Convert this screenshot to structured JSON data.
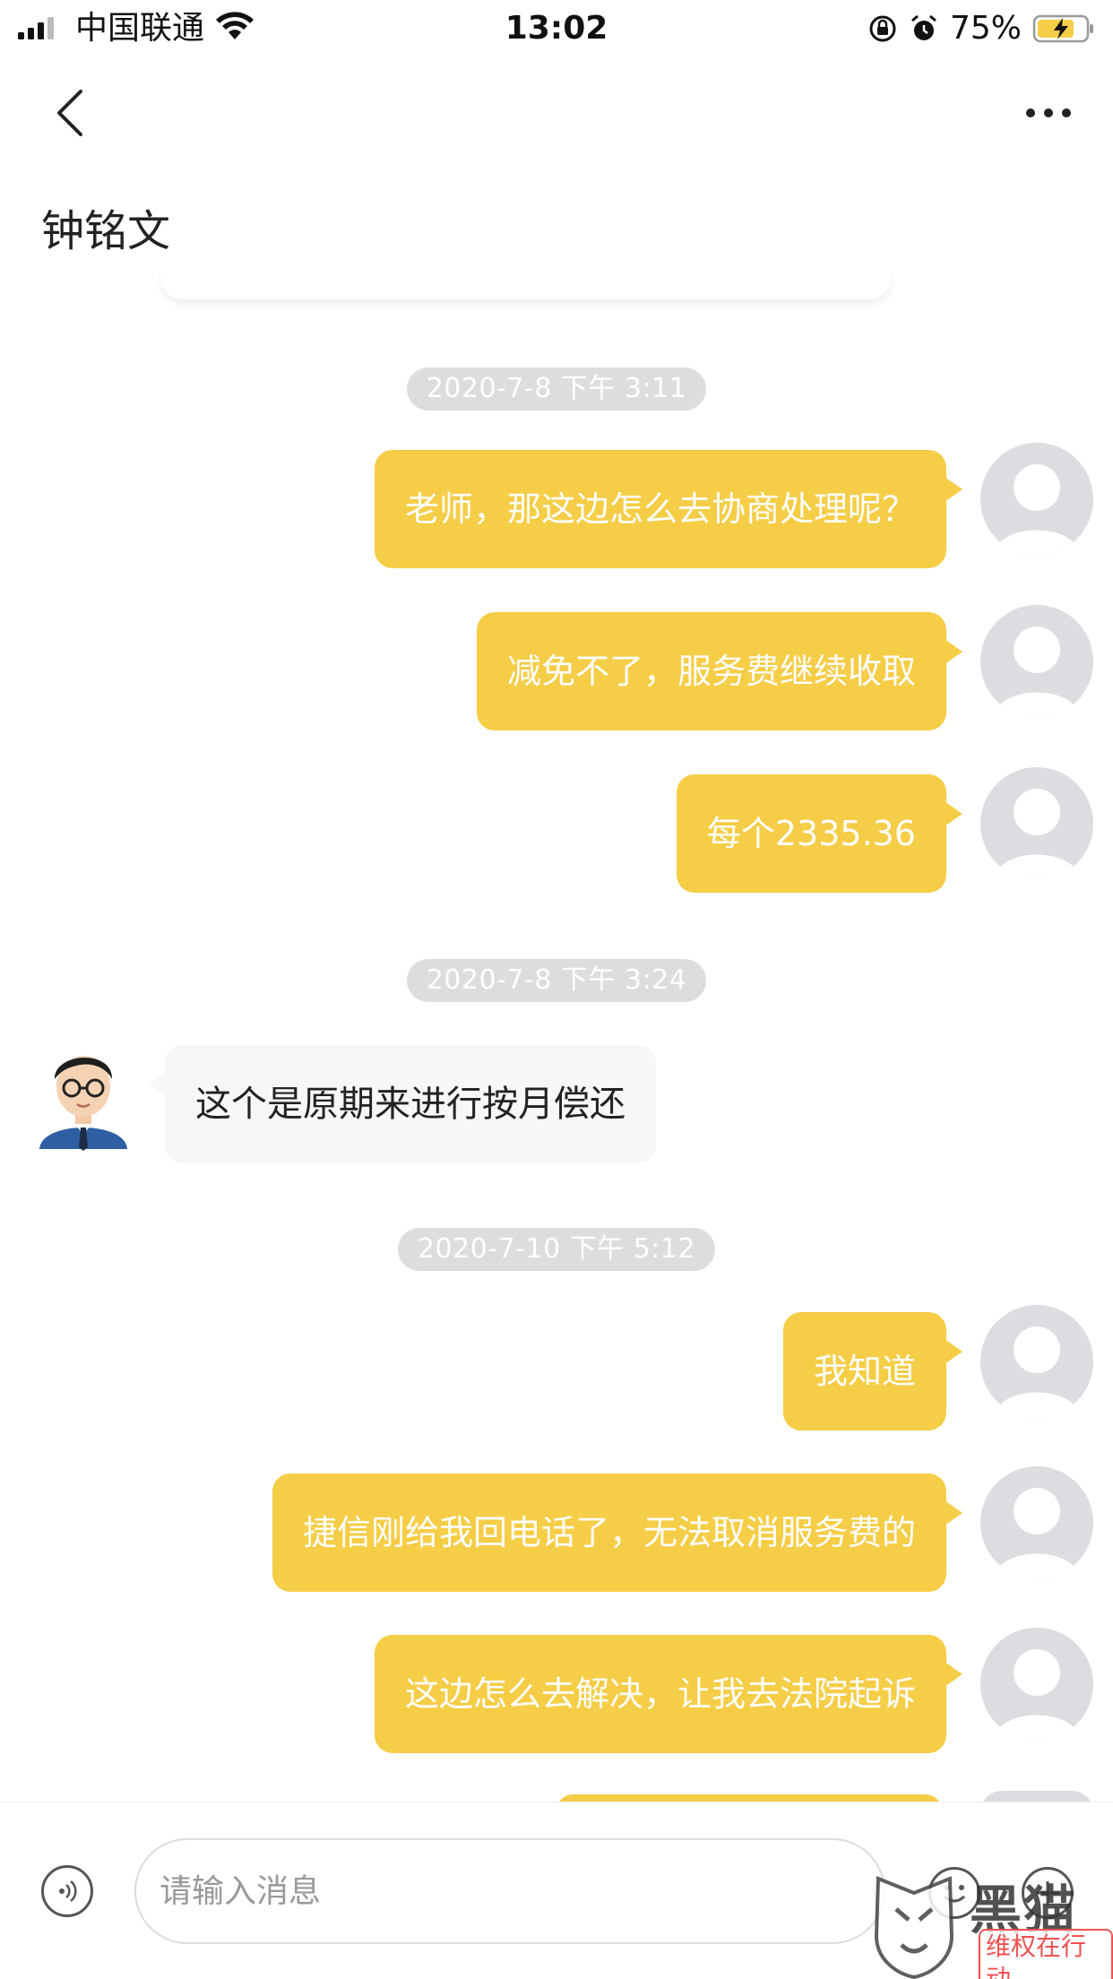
{
  "status_bar": {
    "carrier": "中国联通",
    "time": "13:02",
    "battery_percent": "75%"
  },
  "nav": {
    "back_icon": "chevron-left-icon",
    "more_icon": "more-horizontal-icon"
  },
  "contact": {
    "name": "钟铭文"
  },
  "chat": {
    "timestamps": [
      "2020-7-8 下午 3:11",
      "2020-7-8 下午 3:24",
      "2020-7-10 下午 5:12"
    ],
    "messages": [
      {
        "side": "right",
        "text": "老师，那这边怎么去协商处理呢？"
      },
      {
        "side": "right",
        "text": "减免不了，服务费继续收取"
      },
      {
        "side": "right",
        "text": "每个2335.36"
      },
      {
        "side": "left",
        "text": "这个是原期来进行按月偿还"
      },
      {
        "side": "right",
        "text": "我知道"
      },
      {
        "side": "right",
        "text": "捷信刚给我回电话了，无法取消服务费的"
      },
      {
        "side": "right",
        "text": "这边怎么去解决，让我去法院起诉"
      }
    ]
  },
  "input_bar": {
    "placeholder": "请输入消息"
  },
  "watermark": {
    "title": "黑猫",
    "subtitle": "维权在行动"
  },
  "colors": {
    "bubble_self": "#f5cd47",
    "bubble_other": "#f7f7f7",
    "timestamp_bg": "#dddddd"
  }
}
